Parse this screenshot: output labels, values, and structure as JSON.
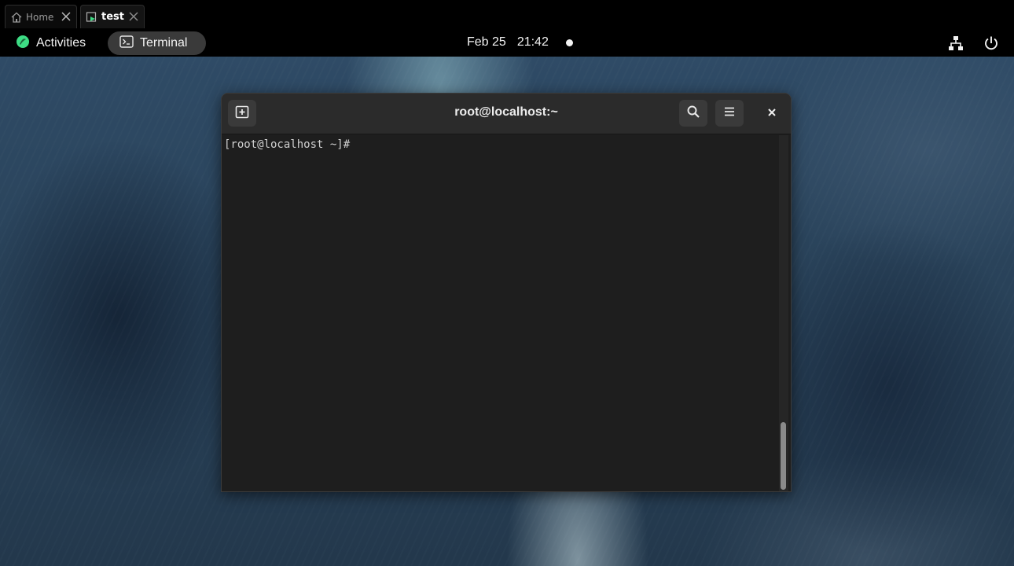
{
  "browser_tabs": [
    {
      "label": "Home",
      "close": "✕"
    },
    {
      "label": "test",
      "close": "✕"
    }
  ],
  "topbar": {
    "activities_label": "Activities",
    "app_label": "Terminal",
    "date": "Feb 25",
    "time": "21:42"
  },
  "terminal": {
    "title": "root@localhost:~",
    "prompt": "[root@localhost ~]#",
    "scroll_position": 1.0
  },
  "colors": {
    "accent_green": "#3ddc84",
    "topbar_bg": "#000000",
    "terminal_bg": "#1e1e1e",
    "header_bg": "#2b2b2b"
  },
  "icons": {
    "home_tab": "home-icon",
    "test_tab": "terminal-tab-icon",
    "activities": "gnome-logo-icon",
    "app_menu": "terminal-app-icon",
    "new_tab": "new-tab-icon",
    "search": "search-icon",
    "menu": "hamburger-icon",
    "close": "close-icon",
    "network": "network-icon",
    "power": "power-icon"
  }
}
